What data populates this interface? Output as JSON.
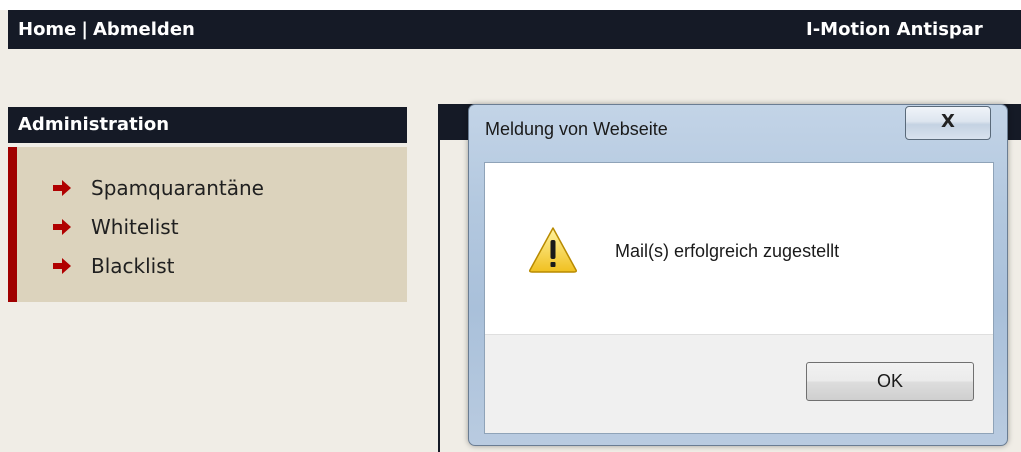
{
  "topbar": {
    "home_label": "Home",
    "separator": "|",
    "logout_label": "Abmelden",
    "brand": "I-Motion Antispar"
  },
  "sidebar": {
    "title": "Administration",
    "items": [
      {
        "label": "Spamquarantäne",
        "icon": "arrow-right-icon"
      },
      {
        "label": "Whitelist",
        "icon": "arrow-right-icon"
      },
      {
        "label": "Blacklist",
        "icon": "arrow-right-icon"
      }
    ]
  },
  "dialog": {
    "title": "Meldung von Webseite",
    "close_label": "X",
    "icon": "warning-icon",
    "message": "Mail(s) erfolgreich zugestellt",
    "ok_label": "OK"
  },
  "colors": {
    "header_bg": "#151a26",
    "sidebar_bg": "#dcd3bd",
    "accent_red": "#a00000",
    "page_bg": "#f0ede6"
  }
}
